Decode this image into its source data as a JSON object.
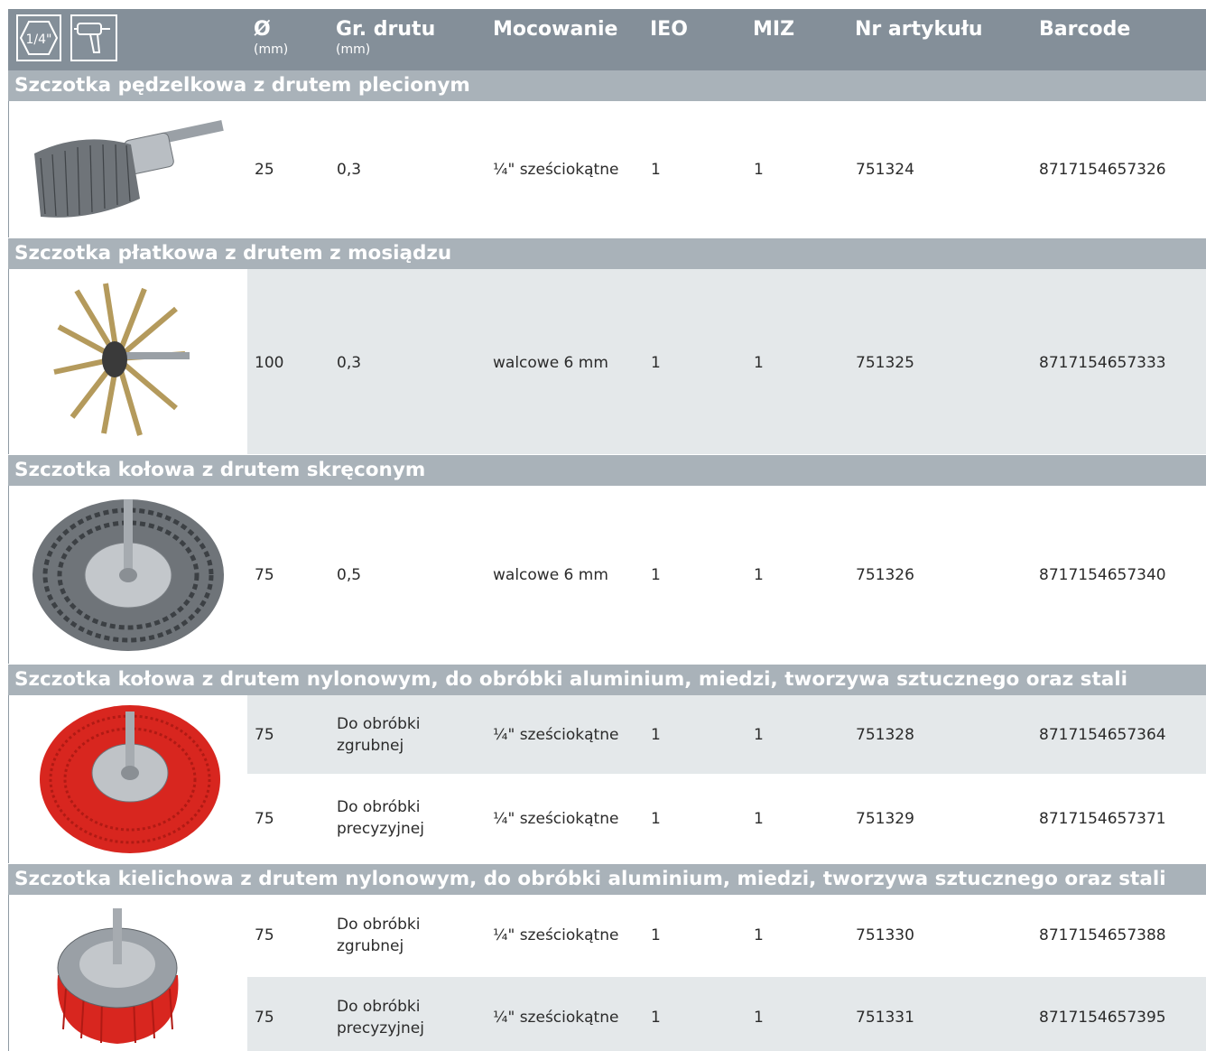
{
  "header": {
    "hex_fraction": "1/4\"",
    "columns": [
      {
        "title": "Ø",
        "unit": "(mm)"
      },
      {
        "title": "Gr. drutu",
        "unit": "(mm)"
      },
      {
        "title": "Mocowanie",
        "unit": ""
      },
      {
        "title": "IEO",
        "unit": ""
      },
      {
        "title": "MIZ",
        "unit": ""
      },
      {
        "title": "Nr artykułu",
        "unit": ""
      },
      {
        "title": "Barcode",
        "unit": ""
      }
    ]
  },
  "colors": {
    "header_bg": "#848f99",
    "section_bg": "#a9b2b9",
    "row_shade": "#e4e8ea",
    "text": "#2b2b2b"
  },
  "sections": [
    {
      "title": "Szczotka pędzelkowa z drutem plecionym",
      "image": "steel-end-brush",
      "rows": [
        {
          "d": "25",
          "wire": "0,3",
          "mount": "¼\" sześciokątne",
          "ieo": "1",
          "miz": "1",
          "art": "751324",
          "barcode": "8717154657326"
        }
      ]
    },
    {
      "title": "Szczotka płatkowa z drutem z mosiądzu",
      "image": "brass-flap-brush",
      "rows": [
        {
          "d": "100",
          "wire": "0,3",
          "mount": "walcowe 6 mm",
          "ieo": "1",
          "miz": "1",
          "art": "751325",
          "barcode": "8717154657333"
        }
      ]
    },
    {
      "title": "Szczotka kołowa z drutem skręconym",
      "image": "twisted-wheel-brush",
      "rows": [
        {
          "d": "75",
          "wire": "0,5",
          "mount": "walcowe 6 mm",
          "ieo": "1",
          "miz": "1",
          "art": "751326",
          "barcode": "8717154657340"
        }
      ]
    },
    {
      "title": "Szczotka kołowa z drutem nylonowym, do obróbki aluminium, miedzi, tworzywa sztucznego oraz stali",
      "image": "red-nylon-wheel-brush",
      "rows": [
        {
          "d": "75",
          "wire1": "Do obróbki",
          "wire2": "zgrubnej",
          "mount": "¼\" sześciokątne",
          "ieo": "1",
          "miz": "1",
          "art": "751328",
          "barcode": "8717154657364"
        },
        {
          "d": "75",
          "wire1": "Do obróbki",
          "wire2": "precyzyjnej",
          "mount": "¼\" sześciokątne",
          "ieo": "1",
          "miz": "1",
          "art": "751329",
          "barcode": "8717154657371"
        }
      ]
    },
    {
      "title": "Szczotka kielichowa z drutem nylonowym, do obróbki aluminium, miedzi, tworzywa sztucznego oraz stali",
      "image": "red-nylon-cup-brush",
      "rows": [
        {
          "d": "75",
          "wire1": "Do obróbki",
          "wire2": "zgrubnej",
          "mount": "¼\" sześciokątne",
          "ieo": "1",
          "miz": "1",
          "art": "751330",
          "barcode": "8717154657388"
        },
        {
          "d": "75",
          "wire1": "Do obróbki",
          "wire2": "precyzyjnej",
          "mount": "¼\" sześciokątne",
          "ieo": "1",
          "miz": "1",
          "art": "751331",
          "barcode": "8717154657395"
        }
      ]
    }
  ]
}
